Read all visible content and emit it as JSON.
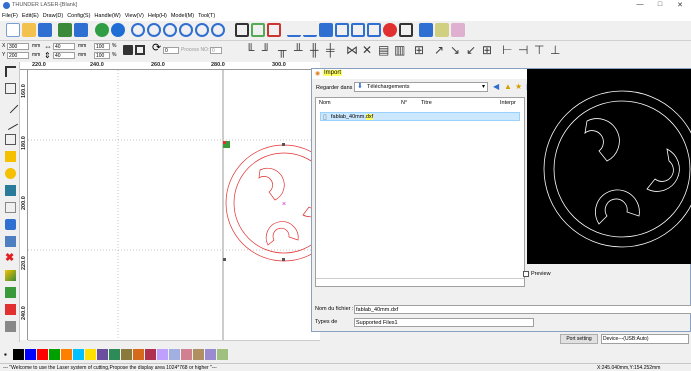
{
  "window": {
    "title": "THUNDER LASER-[Blank]"
  },
  "menu": [
    "File(F)",
    "Edit(E)",
    "Draw(D)",
    "Config(S)",
    "Handle(W)",
    "View(V)",
    "Help(H)",
    "Model(M)",
    "Tool(T)"
  ],
  "toolbar2": {
    "x_label": "X",
    "x_value": "300",
    "y_label": "Y",
    "y_value": "200",
    "w_unit": "mm",
    "h_unit": "mm",
    "w_value": "40",
    "h_value": "40",
    "w_unit2": "mm",
    "h_unit2": "mm",
    "w_pct": "100",
    "h_pct": "100",
    "pct_sign": "%",
    "angle": "0",
    "process_no_label": "Process NO:",
    "process_no": "0"
  },
  "ruler": {
    "top_ticks": [
      "220.0",
      "240.0",
      "260.0",
      "280.0",
      "300.0"
    ],
    "left_ticks": [
      "160.0",
      "180.0",
      "200.0",
      "220.0",
      "240.0"
    ]
  },
  "dialog": {
    "title": "Import",
    "look_in_label": "Regarder dans :",
    "look_in_value": "Téléchargements",
    "columns": [
      "Nom",
      "N°",
      "Titre",
      "Interpr"
    ],
    "file_name_prefix": "fablab_40mm.",
    "file_name_ext": "dxf",
    "preview_label": "Preview",
    "filename_label": "Nom du fichier :",
    "filename_value": "fablab_40mm.dxf",
    "filetype_label": "Types de",
    "filetype_value": "Supported Files1"
  },
  "port": {
    "button": "Port setting",
    "device": "Device---(USB:Auto)"
  },
  "status": {
    "message": "--- \"Welcome to use the Laser system of cutting,Propose the display area 1024*768 or higher \"---",
    "coords": "X:245.040mm,Y:154.252mm"
  },
  "colors": {
    "accent": "#2e6fd1",
    "shape": "#e03030",
    "selection": "#ffff66",
    "palette": [
      "#000000",
      "#0000ff",
      "#ff0000",
      "#00a000",
      "#ff8000",
      "#00c0ff",
      "#ffe000",
      "#6b4f9e",
      "#2e8b57",
      "#8b7a3d",
      "#d46a1a",
      "#b03050",
      "#c0a0ff",
      "#a0b0e0",
      "#d08090",
      "#b09060",
      "#9a8ad0",
      "#a0c080"
    ]
  }
}
